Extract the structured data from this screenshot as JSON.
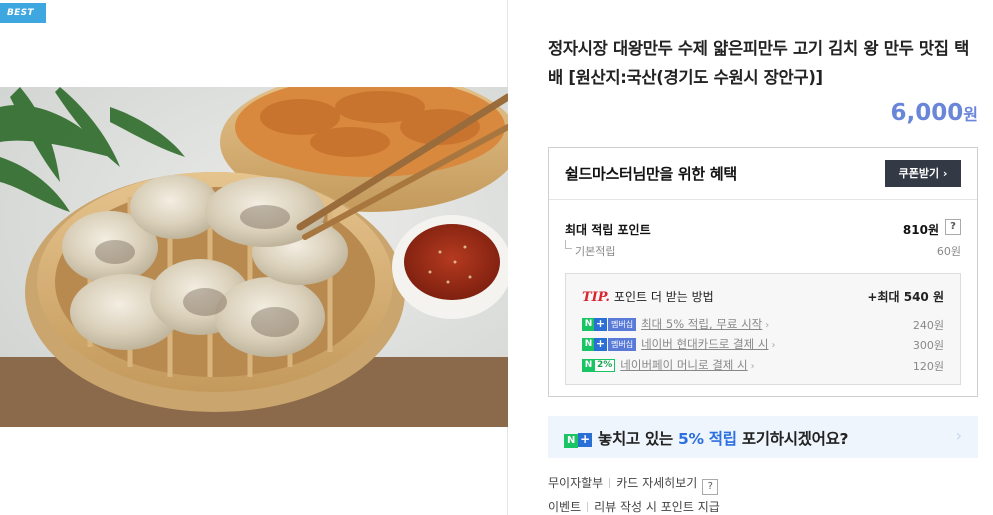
{
  "badge": {
    "best": "BEST"
  },
  "product": {
    "title": "정자시장 대왕만두 수제 얇은피만두 고기 김치 왕 만두 맛집 택배 [원산지:국산(경기도 수원시 장안구)]",
    "price": "6,000",
    "price_unit": "원"
  },
  "benefit": {
    "title": "쉴드마스터님만을 위한 혜택",
    "coupon_label": "쿠폰받기 ›",
    "max_point_label": "최대 적립 포인트",
    "max_point_value": "810원",
    "base_label": "기본적립",
    "base_value": "60원",
    "help_glyph": "?"
  },
  "tip": {
    "label": "TIP.",
    "title": "포인트 더 받는 방법",
    "max": "+최대 540 원",
    "rows": [
      {
        "badge": "멤버십",
        "text": "최대 5% 적립, 무료 시작",
        "value": "240원"
      },
      {
        "badge": "멤버십",
        "text": "네이버 현대카드로 결제 시",
        "value": "300원"
      },
      {
        "badge": "2%",
        "text": "네이버페이 머니로 결제 시",
        "value": "120원"
      }
    ]
  },
  "banner": {
    "text_before": "놓치고 있는 ",
    "highlight": "5% 적립",
    "text_after": " 포기하시겠어요?"
  },
  "links": {
    "installment": "무이자할부",
    "card_detail": "카드 자세히보기",
    "event": "이벤트",
    "review_point": "리뷰 작성 시 포인트 지급"
  },
  "colors": {
    "price": "#6a86d8",
    "best_badge": "#3fa7e0",
    "naver_green": "#19c463",
    "highlight_blue": "#2b6fe0",
    "tip_red": "#d9232d"
  }
}
